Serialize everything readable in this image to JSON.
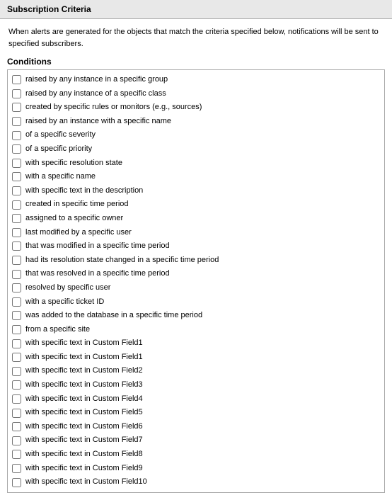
{
  "header": {
    "title": "Subscription Criteria"
  },
  "description": "When alerts are generated for the objects that match the criteria specified below, notifications will be sent to specified subscribers.",
  "conditions": {
    "label": "Conditions",
    "items": [
      "raised by any instance in a specific group",
      "raised by any instance of a specific class",
      "created by specific rules or monitors (e.g., sources)",
      "raised by an instance with a specific name",
      "of a specific severity",
      "of a specific priority",
      "with specific resolution state",
      "with a specific name",
      "with specific text in the description",
      "created in specific time period",
      "assigned to a specific owner",
      "last modified by a specific user",
      "that was modified in a specific time period",
      "had its resolution state changed in a specific time period",
      "that was resolved in a specific time period",
      "resolved by specific user",
      "with a specific ticket ID",
      "was added to the database in a specific time period",
      "from a specific site",
      "with specific text in Custom Field1",
      "with specific text in Custom Field1",
      "with specific text in Custom Field2",
      "with specific text in Custom Field3",
      "with specific text in Custom Field4",
      "with specific text in Custom Field5",
      "with specific text in Custom Field6",
      "with specific text in Custom Field7",
      "with specific text in Custom Field8",
      "with specific text in Custom Field9",
      "with specific text in Custom Field10"
    ]
  }
}
